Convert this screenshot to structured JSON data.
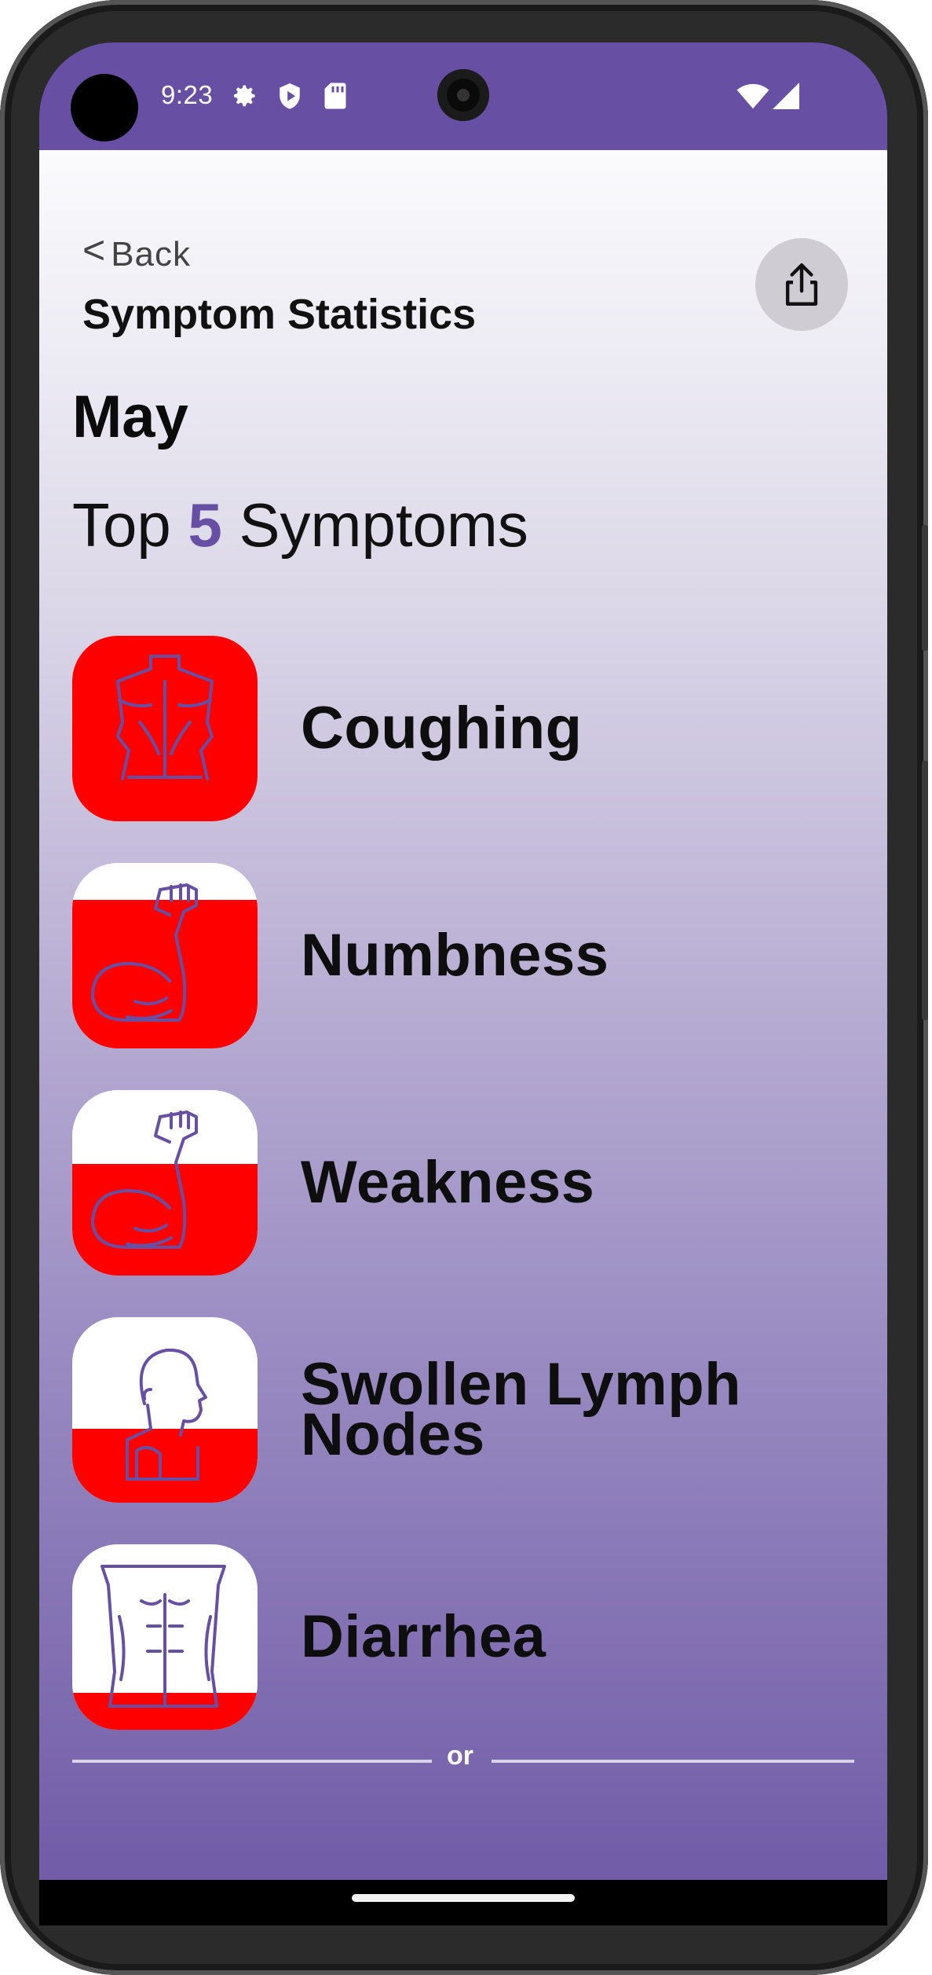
{
  "status_bar": {
    "time": "9:23",
    "left_icons": [
      "gear-icon",
      "shield-play-icon",
      "sd-card-icon"
    ],
    "right_icons": [
      "wifi-icon",
      "cellular-signal-icon"
    ]
  },
  "header": {
    "back_chevron": "<",
    "back_label": "Back",
    "title": "Symptom Statistics",
    "share_icon": "share-icon"
  },
  "month": "May",
  "top_heading": {
    "prefix": "Top",
    "count": "5",
    "suffix": "Symptoms"
  },
  "symptoms": [
    {
      "name": "Coughing",
      "icon": "back-torso-icon",
      "fill_fraction": 1.0
    },
    {
      "name": "Numbness",
      "icon": "flexed-arm-icon",
      "fill_fraction": 0.8
    },
    {
      "name": "Weakness",
      "icon": "flexed-arm-icon",
      "fill_fraction": 0.6
    },
    {
      "name": "Swollen Lymph Nodes",
      "icon": "head-neck-icon",
      "fill_fraction": 0.4
    },
    {
      "name": "Diarrhea",
      "icon": "abdomen-icon",
      "fill_fraction": 0.2
    }
  ],
  "colors": {
    "accent": "#6750a4",
    "severity_fill": "#ff0000",
    "tile_background": "#ffffff",
    "icon_stroke": "#6750a4"
  },
  "divider_label": "or"
}
